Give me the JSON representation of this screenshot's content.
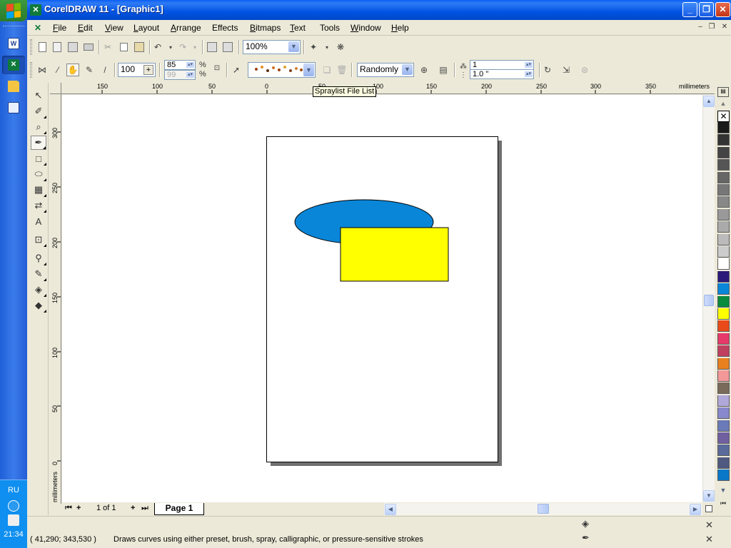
{
  "window": {
    "title": "CorelDRAW 11 - [Graphic1]",
    "app_icon": "coreldraw-icon",
    "caption_buttons": [
      "minimize",
      "maximize",
      "close"
    ]
  },
  "taskbar": {
    "start_icon": "windows-flag-icon",
    "quick_launch": [
      "word-icon",
      "coreldraw-icon",
      "folder-icon",
      "outlook-icon"
    ],
    "tray": {
      "language": "RU",
      "clock": "21:34"
    }
  },
  "menu": {
    "items": [
      {
        "label": "File",
        "u": "F",
        "rest": "ile"
      },
      {
        "label": "Edit",
        "u": "E",
        "rest": "dit"
      },
      {
        "label": "View",
        "u": "V",
        "rest": "iew"
      },
      {
        "label": "Layout",
        "u": "L",
        "rest": "ayout"
      },
      {
        "label": "Arrange",
        "u": "A",
        "rest": "rrange"
      },
      {
        "label": "Effects",
        "u": "",
        "rest": "Effects"
      },
      {
        "label": "Bitmaps",
        "u": "B",
        "rest": "itmaps"
      },
      {
        "label": "Text",
        "u": "T",
        "rest": "ext"
      },
      {
        "label": "Tools",
        "u": "",
        "rest": "Tools"
      },
      {
        "label": "Window",
        "u": "W",
        "rest": "indow"
      },
      {
        "label": "Help",
        "u": "H",
        "rest": "elp"
      }
    ]
  },
  "standard_toolbar": {
    "zoom_level": "100%",
    "icons": [
      "new-icon",
      "open-icon",
      "save-icon",
      "print-icon",
      "cut-icon",
      "copy-icon",
      "paste-icon",
      "undo-icon",
      "redo-icon",
      "import-icon",
      "export-icon",
      "app-launcher-icon",
      "corel-online-icon"
    ]
  },
  "property_bar": {
    "size_value": "100",
    "spray_count_top": "85",
    "spray_count_bottom": "99",
    "spray_order": "Randomly",
    "rotation_value": "1",
    "offset_value": "1.0 \"",
    "tooltip": "Spraylist File List"
  },
  "rulers": {
    "unit": "millimeters",
    "h_ticks": [
      "150",
      "100",
      "50",
      "0",
      "50",
      "100",
      "150",
      "200",
      "250",
      "300",
      "350"
    ],
    "v_ticks": [
      "300",
      "250",
      "200",
      "150",
      "100",
      "50",
      "0"
    ]
  },
  "toolbox": {
    "tools": [
      "pick-tool-icon",
      "shape-tool-icon",
      "zoom-tool-icon",
      "artistic-media-tool-icon",
      "rectangle-tool-icon",
      "ellipse-tool-icon",
      "graph-paper-tool-icon",
      "basic-shapes-tool-icon",
      "text-tool-icon",
      "interactive-blend-tool-icon",
      "eyedropper-tool-icon",
      "outline-tool-icon",
      "fill-tool-icon",
      "interactive-fill-tool-icon"
    ]
  },
  "drawing": {
    "ellipse_color": "#0a86d8",
    "rectangle_color": "#ffff00"
  },
  "page_navigator": {
    "page_count": "1 of 1",
    "page_tab": "Page 1"
  },
  "palette": {
    "colors": [
      "#1a1a1a",
      "#333333",
      "#444444",
      "#555555",
      "#666666",
      "#777777",
      "#888888",
      "#999999",
      "#aaaaaa",
      "#bbbbbb",
      "#cccccc",
      "#ffffff",
      "#2b1a7a",
      "#0a86d8",
      "#0a8a3c",
      "#ffff00",
      "#e84a1a",
      "#e63a6a",
      "#c04060",
      "#e88020",
      "#f29898",
      "#7a6a5a",
      "#b0a8d8",
      "#8888cc",
      "#6a7ab8",
      "#7060a0",
      "#5a6a9a",
      "#505a80",
      "#0a78c8"
    ]
  },
  "status": {
    "coordinates": "( 41,290; 343,530 )",
    "hint": "Draws curves using either preset, brush, spray, calligraphic, or pressure-sensitive strokes"
  }
}
